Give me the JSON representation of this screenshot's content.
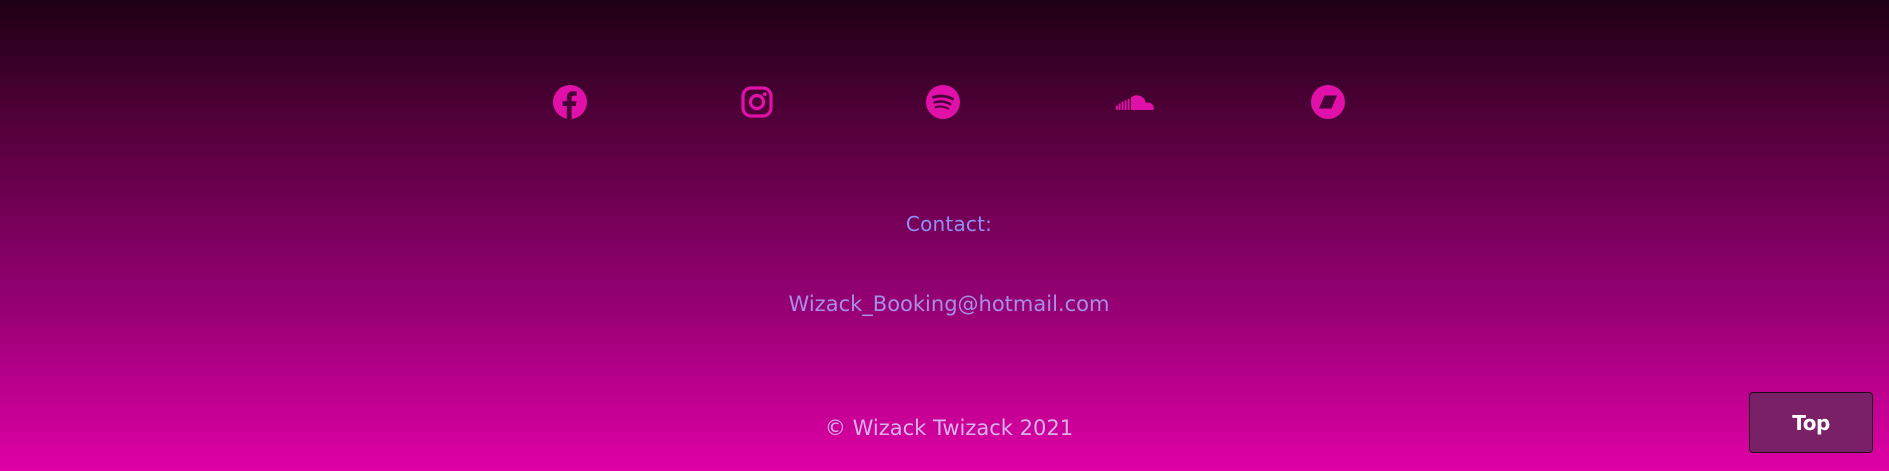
{
  "social": {
    "icon_color": "#e010a8",
    "links": [
      {
        "icon": "facebook-icon"
      },
      {
        "icon": "instagram-icon"
      },
      {
        "icon": "spotify-icon"
      },
      {
        "icon": "soundcloud-icon"
      },
      {
        "icon": "bandcamp-icon"
      }
    ]
  },
  "contact": {
    "label": "Contact:",
    "email": "Wizack_Booking@hotmail.com"
  },
  "footer": {
    "copyright": "© Wizack Twizack 2021"
  },
  "top_button": {
    "label": "Top"
  },
  "colors": {
    "gradient_top": "#1e0014",
    "gradient_bottom": "#e000a6",
    "contact_label": "#8f8ff5",
    "email": "#a78ee8",
    "copyright": "#d8b2ea",
    "top_button_bg": "#7a2066"
  }
}
